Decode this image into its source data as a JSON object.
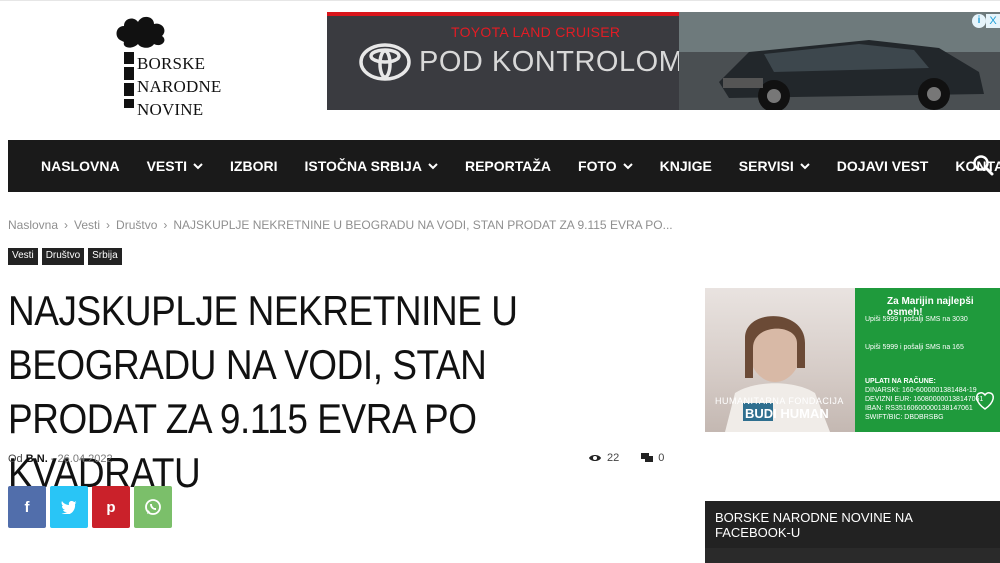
{
  "logo": {
    "line1": "BORSKE",
    "line2": "NARODNE",
    "line3": "NOVINE"
  },
  "top_ad": {
    "subtitle": "TOYOTA LAND CRUISER",
    "title": "POD KONTROLOM",
    "info": "i",
    "close": "X"
  },
  "nav": {
    "items": [
      {
        "label": "NASLOVNA",
        "dropdown": false
      },
      {
        "label": "VESTI",
        "dropdown": true
      },
      {
        "label": "IZBORI",
        "dropdown": false
      },
      {
        "label": "ISTOČNA SRBIJA",
        "dropdown": true
      },
      {
        "label": "REPORTAŽA",
        "dropdown": false
      },
      {
        "label": "FOTO",
        "dropdown": true
      },
      {
        "label": "KNJIGE",
        "dropdown": false
      },
      {
        "label": "SERVISI",
        "dropdown": true
      },
      {
        "label": "DOJAVI VEST",
        "dropdown": false
      },
      {
        "label": "KONTAKT",
        "dropdown": false
      }
    ]
  },
  "breadcrumb": {
    "items": [
      "Naslovna",
      "Vesti",
      "Društvo",
      "NAJSKUPLJE NEKRETNINE U BEOGRADU NA VODI, STAN PRODAT ZA 9.115 EVRA PO..."
    ],
    "separator": "›"
  },
  "tags": [
    "Vesti",
    "Društvo",
    "Srbija"
  ],
  "article": {
    "title": "NAJSKUPLJE NEKRETNINE U BEOGRADU NA VODI, STAN PRODAT ZA 9.115 EVRA PO KVADRATU",
    "by_prefix": "Od",
    "author": "B.N.",
    "dash": "-",
    "date": "26.04.2022",
    "views": "22",
    "comments": "0"
  },
  "share": {
    "facebook": "f",
    "twitter": "t",
    "pinterest": "p",
    "whatsapp": "w",
    "colors": {
      "facebook": "#516eab",
      "twitter": "#29c5f6",
      "pinterest": "#ca212a",
      "whatsapp": "#7bbf6a"
    }
  },
  "side_ad": {
    "title": "Za Marijin najlepši osmeh!",
    "line1": "Upiši 5999 i pošalji SMS na 3030",
    "line2": "Upiši 5999 i pošalji SMS na 165",
    "payments_label": "UPLATI NA RAČUNE:",
    "dinarski": "DINARSKI: 160-6000001381484-19",
    "eur": "DEVIZNI EUR: 160800000138147061",
    "iban": "IBAN: RS35160600000138147061",
    "swift": "SWIFT/BIC: DBDBRSBG",
    "foundation": "HUMANITARNA FONDACIJA",
    "foundation_name": "BUDI HUMAN"
  },
  "facebook_widget": {
    "title": "BORSKE NARODNE NOVINE NA FACEBOOK-U"
  }
}
